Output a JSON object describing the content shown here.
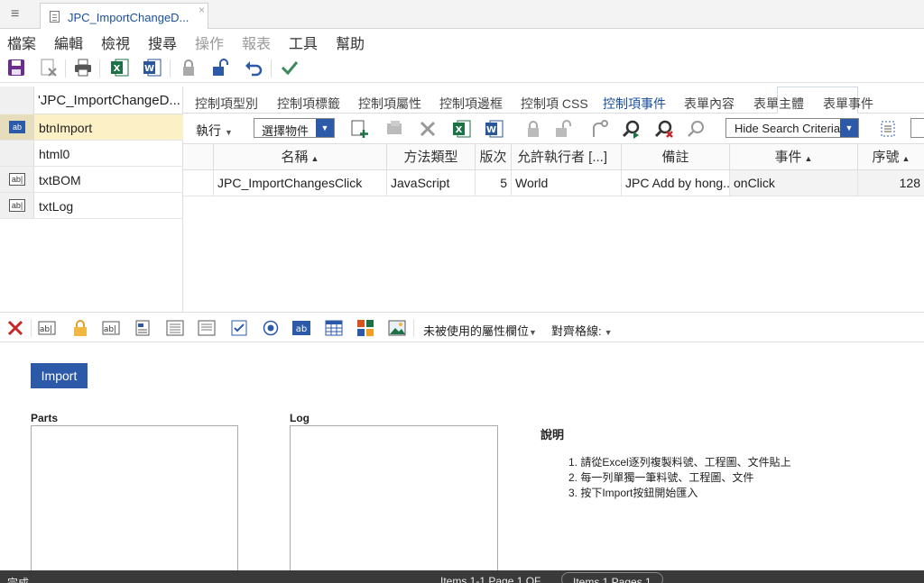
{
  "window": {
    "tab_title": "JPC_ImportChangeD...",
    "close_glyph": "×",
    "menu_glyph": "≡"
  },
  "menu": [
    "檔案",
    "編輯",
    "檢視",
    "搜尋",
    "操作",
    "報表",
    "工具",
    "幫助"
  ],
  "left_panel": {
    "header": "'JPC_ImportChangeD...",
    "items": [
      {
        "label": "btnImport",
        "icon": "ab"
      },
      {
        "label": "html0",
        "icon": ""
      },
      {
        "label": "txtBOM",
        "icon": "ab|"
      },
      {
        "label": "txtLog",
        "icon": "ab|"
      }
    ]
  },
  "tabs": [
    "控制項型別",
    "控制項標籤",
    "控制項屬性",
    "控制項邊框",
    "控制項 CSS",
    "控制項事件",
    "表單內容",
    "表單主體",
    "表單事件"
  ],
  "subtoolbar": {
    "execute": "執行",
    "select_object": "選擇物件",
    "hide_search": "Hide Search Criteria"
  },
  "grid": {
    "headers": [
      "名稱",
      "方法類型",
      "版次",
      "允許執行者 [...]",
      "備註",
      "事件",
      "序號"
    ],
    "rows": [
      [
        "JPC_ImportChangesClick",
        "JavaScript",
        "5",
        "World",
        "JPC Add by hong...",
        "onClick",
        "128"
      ]
    ]
  },
  "toolbox": {
    "unused_props": "未被使用的屬性欄位",
    "align_grid": "對齊格線:"
  },
  "canvas": {
    "import_label": "Import",
    "parts_label": "Parts",
    "log_label": "Log",
    "desc_title": "說明",
    "desc_items": [
      "1. 請從Excel逐列複製料號、工程圖、文件貼上",
      "2. 每一列單獨一筆料號、工程圖、文件",
      "3. 按下Import按鈕開始匯入"
    ]
  },
  "status": {
    "left": "完成",
    "items": "Items 1-1 Page 1 OF",
    "items_pages": "Items 1 Pages 1"
  },
  "colors": {
    "accent": "#2c5aa8",
    "selected_row": "#fbf0c6",
    "excel_green": "#1e7145",
    "word_blue": "#2b579a",
    "delete_red": "#c62828"
  }
}
